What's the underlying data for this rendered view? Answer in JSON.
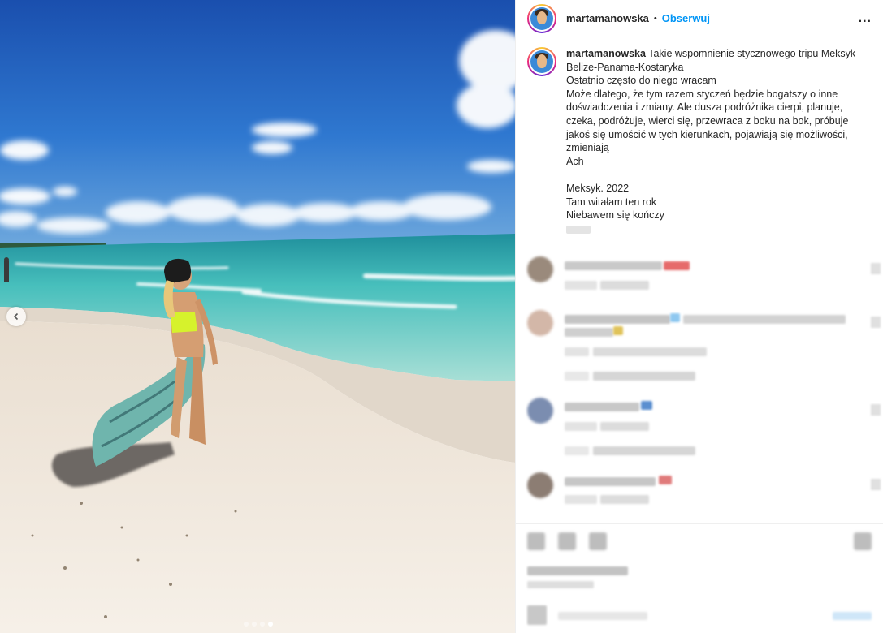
{
  "post": {
    "username": "martamanowska",
    "follow_label": "Obserwuj",
    "header_separator": "•",
    "more_label": "...",
    "caption": {
      "username": "martamanowska",
      "lines": [
        "Takie wspomnienie stycznowego tripu Meksyk-",
        "Belize-Panama-Kostaryka",
        "Ostatnio często do niego wracam",
        "Może dlatego, że tym razem styczeń będzie bogatszy o inne",
        "doświadczenia i zmiany. Ale dusza podróżnika cierpi, planuje,",
        "czeka, podróżuje, wierci się, przewraca z boku na bok, próbuje",
        "jakoś się umościć w tych kierunkach, pojawiają się możliwości,",
        "zmieniają",
        "Ach",
        "",
        "Meksyk. 2022",
        "Tam witałam ten rok",
        "Niebawem się kończy"
      ]
    }
  },
  "carousel": {
    "prev_icon": "chevron-left-icon",
    "total_dots": 4,
    "active_dot": 3
  },
  "colors": {
    "accent": "#0095f6",
    "text": "#262626",
    "sky_top": "#1f5fb8",
    "sea": "#52c4c0",
    "sand": "#f3ece2"
  }
}
